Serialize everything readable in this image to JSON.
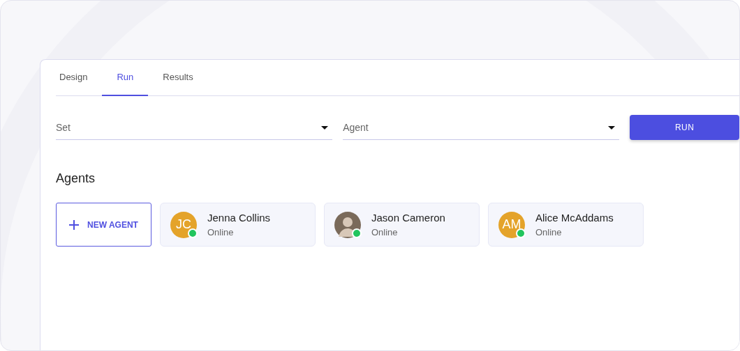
{
  "tabs": [
    {
      "label": "Design",
      "selected": false
    },
    {
      "label": "Run",
      "selected": true
    },
    {
      "label": "Results",
      "selected": false
    }
  ],
  "selects": [
    {
      "placeholder": "Set"
    },
    {
      "placeholder": "Agent"
    }
  ],
  "run_button": "RUN",
  "agents_section": {
    "title": "Agents",
    "new_button": "NEW AGENT",
    "agents": [
      {
        "name": "Jenna Collins",
        "status": "Online",
        "avatar": {
          "kind": "initials",
          "text": "JC"
        },
        "color": "#22c55e"
      },
      {
        "name": "Jason Cameron",
        "status": "Online",
        "avatar": {
          "kind": "photo"
        },
        "color": "#22c55e"
      },
      {
        "name": "Alice McAddams",
        "status": "Online",
        "avatar": {
          "kind": "initials",
          "text": "AM"
        },
        "color": "#22c55e"
      }
    ]
  }
}
